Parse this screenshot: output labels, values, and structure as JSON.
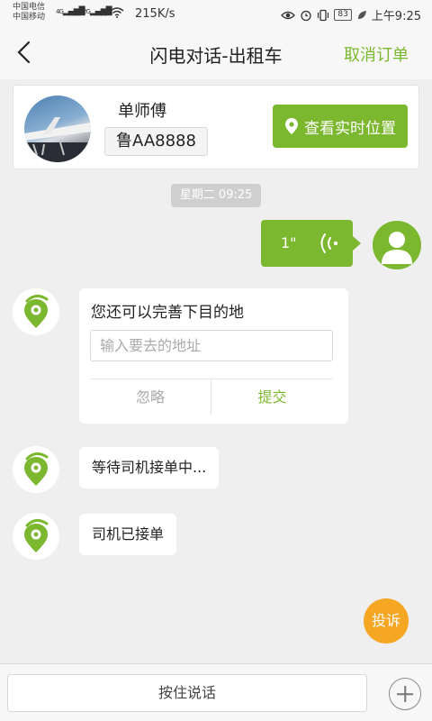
{
  "status_bar": {
    "carrier_1": "中国电信",
    "carrier_2": "中国移动",
    "net_1": "4G",
    "net_2": "2G",
    "speed": "215K/s",
    "battery": "83",
    "time": "上午9:25"
  },
  "nav": {
    "title": "闪电对话-出租车",
    "cancel_label": "取消订单"
  },
  "driver": {
    "name": "单师傅",
    "plate": "鲁AA8888",
    "location_label": "查看实时位置"
  },
  "chat": {
    "timestamp": "星期二 09:25",
    "voice_duration": "1\"",
    "destination_prompt": "您还可以完善下目的地",
    "destination_placeholder": "输入要去的地址",
    "ignore_label": "忽略",
    "submit_label": "提交",
    "waiting_message": "等待司机接单中...",
    "accepted_message": "司机已接单"
  },
  "complain_label": "投诉",
  "bottom": {
    "hold_to_talk": "按住说话"
  },
  "colors": {
    "accent": "#7cb82f",
    "complain": "#f5a623",
    "background": "#efefef"
  }
}
